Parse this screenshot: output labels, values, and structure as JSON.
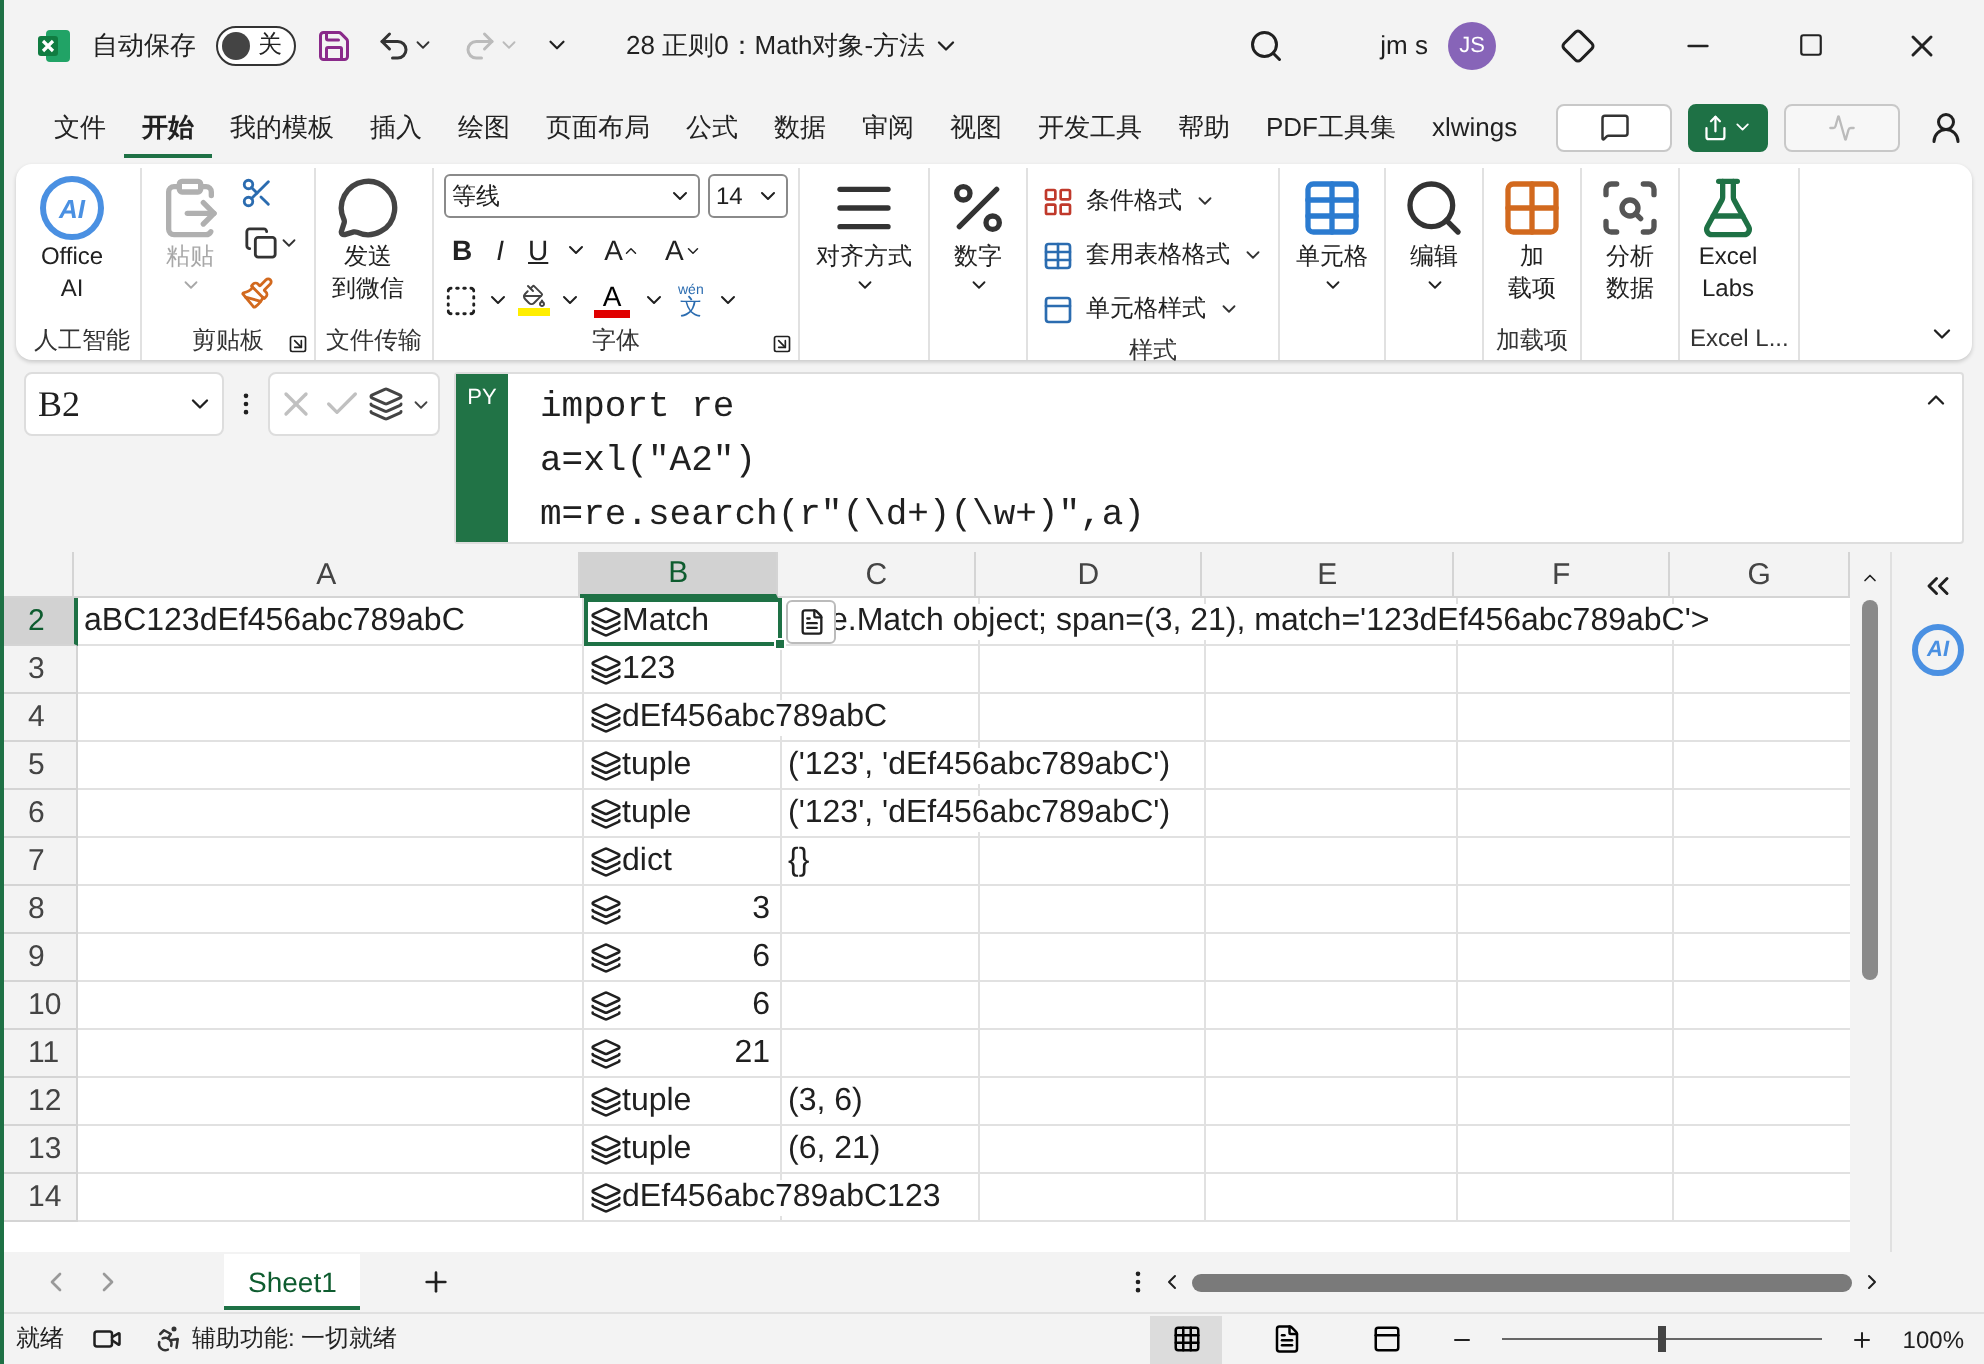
{
  "title_bar": {
    "autosave_label": "自动保存",
    "autosave": {
      "on": false,
      "label": "关"
    },
    "document_title": "28 正则0：Math对象-方法",
    "user_name": "jm s",
    "avatar_initials": "JS"
  },
  "ribbon_tabs": [
    {
      "label": "文件",
      "selected": false
    },
    {
      "label": "开始",
      "selected": true
    },
    {
      "label": "我的模板",
      "selected": false
    },
    {
      "label": "插入",
      "selected": false
    },
    {
      "label": "绘图",
      "selected": false
    },
    {
      "label": "页面布局",
      "selected": false
    },
    {
      "label": "公式",
      "selected": false
    },
    {
      "label": "数据",
      "selected": false
    },
    {
      "label": "审阅",
      "selected": false
    },
    {
      "label": "视图",
      "selected": false
    },
    {
      "label": "开发工具",
      "selected": false
    },
    {
      "label": "帮助",
      "selected": false
    },
    {
      "label": "PDF工具集",
      "selected": false
    },
    {
      "label": "xlwings",
      "selected": false
    }
  ],
  "ribbon_groups": [
    {
      "label": "人工智能",
      "items": [
        {
          "kind": "big",
          "logo_text": "AI",
          "lines": [
            "Office",
            "AI"
          ]
        }
      ]
    },
    {
      "label": "剪贴板",
      "launcher": true,
      "items": [
        {
          "kind": "big",
          "lines": [
            "粘贴"
          ],
          "dropdown": true,
          "disabled": true
        },
        {
          "kind": "clipboard_tools"
        }
      ]
    },
    {
      "label": "文件传输",
      "items": [
        {
          "kind": "big",
          "lines": [
            "发送",
            "到微信"
          ]
        }
      ]
    },
    {
      "label": "字体",
      "launcher": true,
      "items": [
        {
          "kind": "font",
          "font": "等线",
          "size": "14",
          "bold": "B",
          "italic": "I",
          "underline": "U",
          "grow": "A",
          "shrink": "A",
          "font_color": "A",
          "phonetic_top": "wén",
          "phonetic_bottom": "文"
        }
      ]
    },
    {
      "items": [
        {
          "kind": "big",
          "lines": [
            "对齐方式"
          ],
          "dropdown": true
        }
      ]
    },
    {
      "items": [
        {
          "kind": "big",
          "lines": [
            "数字"
          ],
          "dropdown": true
        }
      ]
    },
    {
      "label": "样式",
      "items": [
        {
          "kind": "menu_rows",
          "rows": [
            {
              "label": "条件格式"
            },
            {
              "label": "套用表格格式"
            },
            {
              "label": "单元格样式"
            }
          ]
        }
      ]
    },
    {
      "items": [
        {
          "kind": "big",
          "lines": [
            "单元格"
          ],
          "dropdown": true
        }
      ]
    },
    {
      "items": [
        {
          "kind": "big",
          "lines": [
            "编辑"
          ],
          "dropdown": true
        }
      ]
    },
    {
      "label": "加载项",
      "items": [
        {
          "kind": "big",
          "lines": [
            "加",
            "载项"
          ]
        }
      ]
    },
    {
      "items": [
        {
          "kind": "big",
          "lines": [
            "分析",
            "数据"
          ]
        }
      ]
    },
    {
      "label": "Excel L...",
      "items": [
        {
          "kind": "big",
          "lines": [
            "Excel",
            "Labs"
          ]
        }
      ]
    }
  ],
  "formula_bar": {
    "name_box": "B2",
    "badge": "PY",
    "code_lines": [
      "import re",
      "a=xl(\"A2\")",
      "m=re.search(r\"(\\d+)(\\w+)\",a)"
    ]
  },
  "sheet": {
    "columns": [
      {
        "label": "A",
        "selected": false
      },
      {
        "label": "B",
        "selected": true
      },
      {
        "label": "C",
        "selected": false
      },
      {
        "label": "D",
        "selected": false
      },
      {
        "label": "E",
        "selected": false
      },
      {
        "label": "F",
        "selected": false
      },
      {
        "label": "G",
        "selected": false
      }
    ],
    "rows": [
      {
        "header": "2",
        "selected": true,
        "col_a": {
          "text": "aBC123dEf456abc789abC"
        },
        "col_b": {
          "text": "Match",
          "python": true
        },
        "col_c": {
          "text": "e.Match object; span=(3, 21), match='123dEf456abc789abC'>"
        }
      },
      {
        "header": "3",
        "selected": false,
        "col_b": {
          "text": "123",
          "python": true
        }
      },
      {
        "header": "4",
        "selected": false,
        "col_b": {
          "text": "dEf456abc789abC",
          "python": true
        }
      },
      {
        "header": "5",
        "selected": false,
        "col_b": {
          "text": "tuple",
          "python": true
        },
        "col_c": {
          "text": "('123', 'dEf456abc789abC')"
        }
      },
      {
        "header": "6",
        "selected": false,
        "col_b": {
          "text": "tuple",
          "python": true
        },
        "col_c": {
          "text": "('123', 'dEf456abc789abC')"
        }
      },
      {
        "header": "7",
        "selected": false,
        "col_b": {
          "text": "dict",
          "python": true
        },
        "col_c": {
          "text": "{}"
        }
      },
      {
        "header": "8",
        "selected": false,
        "col_b": {
          "text": "3",
          "kind": "number",
          "python": true
        }
      },
      {
        "header": "9",
        "selected": false,
        "col_b": {
          "text": "6",
          "kind": "number",
          "python": true
        }
      },
      {
        "header": "10",
        "selected": false,
        "col_b": {
          "text": "6",
          "kind": "number",
          "python": true
        }
      },
      {
        "header": "11",
        "selected": false,
        "col_b": {
          "text": "21",
          "kind": "number",
          "python": true
        }
      },
      {
        "header": "12",
        "selected": false,
        "col_b": {
          "text": "tuple",
          "python": true
        },
        "col_c": {
          "text": "(3, 6)"
        }
      },
      {
        "header": "13",
        "selected": false,
        "col_b": {
          "text": "tuple",
          "python": true
        },
        "col_c": {
          "text": "(6, 21)"
        }
      },
      {
        "header": "14",
        "selected": false,
        "col_b": {
          "text": "dEf456abc789abC123",
          "python": true
        }
      }
    ]
  },
  "side_pane": {
    "ai_badge": "AI"
  },
  "sheet_tabs": [
    {
      "label": "Sheet1",
      "selected": true
    }
  ],
  "status_bar": {
    "status": "就绪",
    "accessibility": "辅助功能: 一切就绪",
    "views": [
      {
        "kind": "normal",
        "selected": true
      },
      {
        "kind": "page_layout",
        "selected": false
      },
      {
        "kind": "page_break",
        "selected": false
      }
    ],
    "zoom_slider": {
      "level": 0.5
    },
    "zoom": "100%"
  }
}
